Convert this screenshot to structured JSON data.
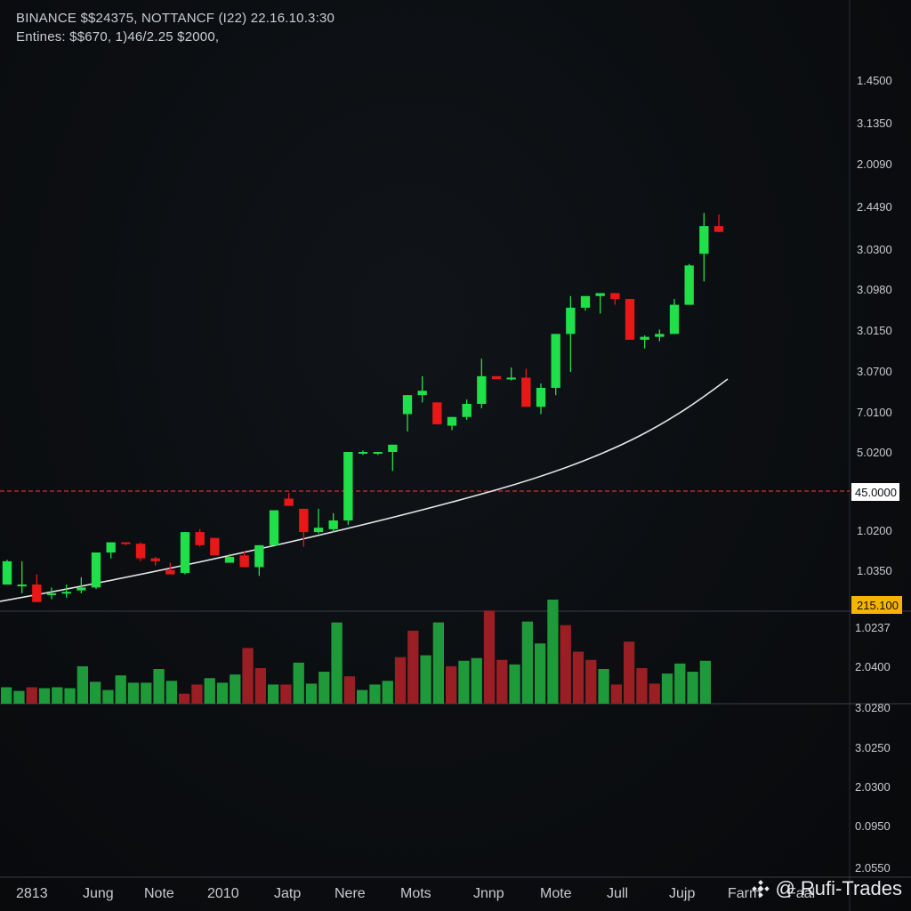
{
  "header": {
    "line1": "BINANCE $$24375, NOTTANCF (I22) 22.16.10.3:30",
    "line2": "Entines: $$670, 1)46/2.25 $2000,"
  },
  "watermark": {
    "text": "@ Rufi-Trades",
    "icon": "binance-diamond-icon"
  },
  "colors": {
    "background": "#0b0d10",
    "bull": "#1fe04a",
    "bear": "#e81818",
    "bull_volume": "#1f9a3a",
    "bear_volume": "#9a1f24",
    "trendline": "#e6e6e6",
    "horizontal_line": "#d23030",
    "axis_text": "#c8cbcf",
    "price_tag_bg": "#ffffff",
    "volume_tag_bg": "#f5b400"
  },
  "chart_data": {
    "type": "candlestick",
    "price_axis_labels": [
      "1.4500",
      "3.1350",
      "2.0090",
      "2.4490",
      "3.0300",
      "3.0980",
      "3.0150",
      "3.0700",
      "7.0100",
      "5.0200",
      "1.0200",
      "1.0350"
    ],
    "price_tag": "45.0000",
    "volume_axis_labels": [
      "1.0237",
      "2.0400",
      "3.0280",
      "3.0250",
      "2.0300",
      "0.0950",
      "2.0550"
    ],
    "volume_tag": "215.100",
    "x_tick_labels": [
      "2813",
      "Jung",
      "Note",
      "2010",
      "Jatp",
      "Nere",
      "Mots",
      "Jnnp",
      "Mote",
      "Jull",
      "Jujp",
      "Farm",
      "Faal"
    ],
    "grid": false,
    "candles": [
      {
        "o": 4,
        "h": 21,
        "l": 6,
        "c": 20
      },
      {
        "o": 3,
        "h": 20,
        "l": -2,
        "c": 4
      },
      {
        "o": 4,
        "h": 11,
        "l": -3,
        "c": -8
      },
      {
        "o": -3,
        "h": 2,
        "l": -6,
        "c": -2
      },
      {
        "o": -2,
        "h": 4,
        "l": -5,
        "c": -1
      },
      {
        "o": 0,
        "h": 9,
        "l": -2,
        "c": 2
      },
      {
        "o": 2,
        "h": 13,
        "l": 1,
        "c": 26
      },
      {
        "o": 26,
        "h": 33,
        "l": 22,
        "c": 33
      },
      {
        "o": 33,
        "h": 33,
        "l": 31,
        "c": 32
      },
      {
        "o": 32,
        "h": 33,
        "l": 20,
        "c": 22
      },
      {
        "o": 22,
        "h": 23,
        "l": 17,
        "c": 20
      },
      {
        "o": 14,
        "h": 19,
        "l": 12,
        "c": 11
      },
      {
        "o": 12,
        "h": 32,
        "l": 11,
        "c": 40
      },
      {
        "o": 40,
        "h": 42,
        "l": 30,
        "c": 31
      },
      {
        "o": 36,
        "h": 32,
        "l": 25,
        "c": 24
      },
      {
        "o": 19,
        "h": 25,
        "l": 21,
        "c": 23
      },
      {
        "o": 24,
        "h": 27,
        "l": 17,
        "c": 16
      },
      {
        "o": 16,
        "h": 27,
        "l": 10,
        "c": 31
      },
      {
        "o": 31,
        "h": 52,
        "l": 52,
        "c": 55
      },
      {
        "o": 63,
        "h": 67,
        "l": 58,
        "c": 58
      },
      {
        "o": 56,
        "h": 51,
        "l": 30,
        "c": 40
      },
      {
        "o": 40,
        "h": 56,
        "l": 39,
        "c": 43
      },
      {
        "o": 42,
        "h": 53,
        "l": 40,
        "c": 48
      },
      {
        "o": 48,
        "h": 95,
        "l": 45,
        "c": 95
      },
      {
        "o": 95,
        "h": 96,
        "l": 93,
        "c": 95
      },
      {
        "o": 95,
        "h": 92,
        "l": 93,
        "c": 95
      },
      {
        "o": 95,
        "h": 100,
        "l": 82,
        "c": 100
      },
      {
        "o": 121,
        "h": 134,
        "l": 109,
        "c": 134
      },
      {
        "o": 134,
        "h": 147,
        "l": 129,
        "c": 137
      },
      {
        "o": 129,
        "h": 128,
        "l": 114,
        "c": 114
      },
      {
        "o": 113,
        "h": 115,
        "l": 110,
        "c": 119
      },
      {
        "o": 119,
        "h": 131,
        "l": 117,
        "c": 128
      },
      {
        "o": 128,
        "h": 159,
        "l": 125,
        "c": 147
      },
      {
        "o": 147,
        "h": 147,
        "l": 147,
        "c": 145
      },
      {
        "o": 145,
        "h": 153,
        "l": 144,
        "c": 146
      },
      {
        "o": 146,
        "h": 152,
        "l": 126,
        "c": 126
      },
      {
        "o": 126,
        "h": 142,
        "l": 121,
        "c": 139
      },
      {
        "o": 139,
        "h": 154,
        "l": 134,
        "c": 176
      },
      {
        "o": 176,
        "h": 202,
        "l": 150,
        "c": 194
      },
      {
        "o": 194,
        "h": 198,
        "l": 192,
        "c": 202
      },
      {
        "o": 202,
        "h": 204,
        "l": 190,
        "c": 204
      },
      {
        "o": 204,
        "h": 202,
        "l": 196,
        "c": 200
      },
      {
        "o": 200,
        "h": 200,
        "l": 172,
        "c": 172
      },
      {
        "o": 172,
        "h": 175,
        "l": 166,
        "c": 174
      },
      {
        "o": 174,
        "h": 179,
        "l": 171,
        "c": 176
      },
      {
        "o": 176,
        "h": 200,
        "l": 178,
        "c": 196
      },
      {
        "o": 196,
        "h": 224,
        "l": 197,
        "c": 223
      },
      {
        "o": 231,
        "h": 259,
        "l": 212,
        "c": 250
      },
      {
        "o": 250,
        "h": 258,
        "l": 254,
        "c": 246
      }
    ],
    "volumes": [
      {
        "v": 18,
        "dir": "bull"
      },
      {
        "v": 14,
        "dir": "bull"
      },
      {
        "v": 18,
        "dir": "bear"
      },
      {
        "v": 17,
        "dir": "bull"
      },
      {
        "v": 18,
        "dir": "bull"
      },
      {
        "v": 17,
        "dir": "bull"
      },
      {
        "v": 41,
        "dir": "bull"
      },
      {
        "v": 24,
        "dir": "bull"
      },
      {
        "v": 15,
        "dir": "bull"
      },
      {
        "v": 31,
        "dir": "bull"
      },
      {
        "v": 23,
        "dir": "bull"
      },
      {
        "v": 23,
        "dir": "bull"
      },
      {
        "v": 38,
        "dir": "bull"
      },
      {
        "v": 25,
        "dir": "bull"
      },
      {
        "v": 11,
        "dir": "bear"
      },
      {
        "v": 21,
        "dir": "bear"
      },
      {
        "v": 28,
        "dir": "bull"
      },
      {
        "v": 23,
        "dir": "bull"
      },
      {
        "v": 32,
        "dir": "bull"
      },
      {
        "v": 61,
        "dir": "bear"
      },
      {
        "v": 39,
        "dir": "bear"
      },
      {
        "v": 21,
        "dir": "bull"
      },
      {
        "v": 21,
        "dir": "bear"
      },
      {
        "v": 45,
        "dir": "bull"
      },
      {
        "v": 22,
        "dir": "bull"
      },
      {
        "v": 35,
        "dir": "bull"
      },
      {
        "v": 89,
        "dir": "bull"
      },
      {
        "v": 30,
        "dir": "bear"
      },
      {
        "v": 15,
        "dir": "bull"
      },
      {
        "v": 21,
        "dir": "bull"
      },
      {
        "v": 25,
        "dir": "bull"
      },
      {
        "v": 51,
        "dir": "bear"
      },
      {
        "v": 80,
        "dir": "bear"
      },
      {
        "v": 53,
        "dir": "bull"
      },
      {
        "v": 89,
        "dir": "bull"
      },
      {
        "v": 41,
        "dir": "bear"
      },
      {
        "v": 47,
        "dir": "bull"
      },
      {
        "v": 50,
        "dir": "bull"
      },
      {
        "v": 102,
        "dir": "bear"
      },
      {
        "v": 48,
        "dir": "bear"
      },
      {
        "v": 43,
        "dir": "bull"
      },
      {
        "v": 90,
        "dir": "bull"
      },
      {
        "v": 66,
        "dir": "bull"
      },
      {
        "v": 114,
        "dir": "bull"
      },
      {
        "v": 86,
        "dir": "bear"
      },
      {
        "v": 57,
        "dir": "bear"
      },
      {
        "v": 48,
        "dir": "bear"
      },
      {
        "v": 38,
        "dir": "bull"
      },
      {
        "v": 21,
        "dir": "bear"
      },
      {
        "v": 68,
        "dir": "bear"
      },
      {
        "v": 39,
        "dir": "bear"
      },
      {
        "v": 22,
        "dir": "bear"
      },
      {
        "v": 33,
        "dir": "bull"
      },
      {
        "v": 44,
        "dir": "bull"
      },
      {
        "v": 35,
        "dir": "bull"
      },
      {
        "v": 47,
        "dir": "bull"
      }
    ]
  }
}
